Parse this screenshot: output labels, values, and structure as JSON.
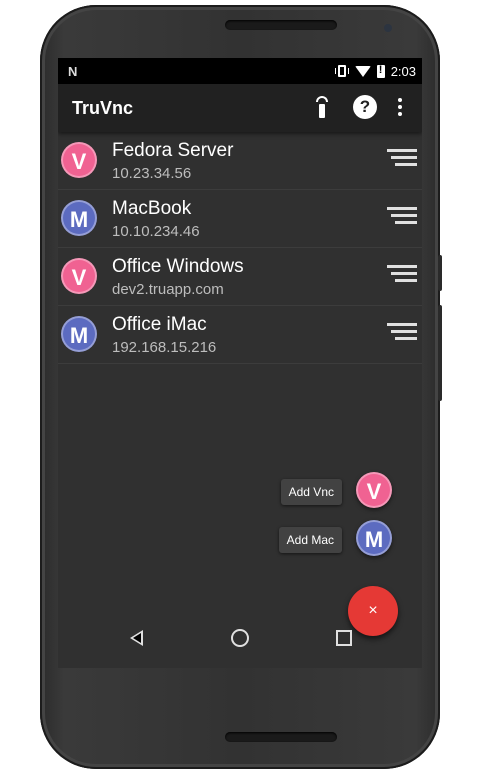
{
  "status_bar": {
    "time": "2:03",
    "notification_icon": "N",
    "icons": [
      "vibrate-icon",
      "wifi-icon",
      "battery-alert-icon"
    ]
  },
  "app_bar": {
    "title": "TruVnc",
    "actions": [
      "remote-icon",
      "help-icon",
      "more-vert-icon"
    ],
    "help_glyph": "?"
  },
  "servers": [
    {
      "name": "Fedora Server",
      "address": "10.23.34.56",
      "avatar_letter": "V",
      "avatar_color": "#f06292"
    },
    {
      "name": "MacBook",
      "address": "10.10.234.46",
      "avatar_letter": "M",
      "avatar_color": "#5c6bc0"
    },
    {
      "name": "Office Windows",
      "address": "dev2.truapp.com",
      "avatar_letter": "V",
      "avatar_color": "#f06292"
    },
    {
      "name": "Office iMac",
      "address": "192.168.15.216",
      "avatar_letter": "M",
      "avatar_color": "#5c6bc0"
    }
  ],
  "fab_menu": {
    "items": [
      {
        "label": "Add Vnc",
        "letter": "V",
        "color": "#f06292"
      },
      {
        "label": "Add Mac",
        "letter": "M",
        "color": "#5c6bc0"
      }
    ],
    "close_glyph": "×",
    "fab_color": "#e53935"
  },
  "nav_bar": {
    "buttons": [
      "back-icon",
      "home-icon",
      "recents-icon"
    ]
  }
}
